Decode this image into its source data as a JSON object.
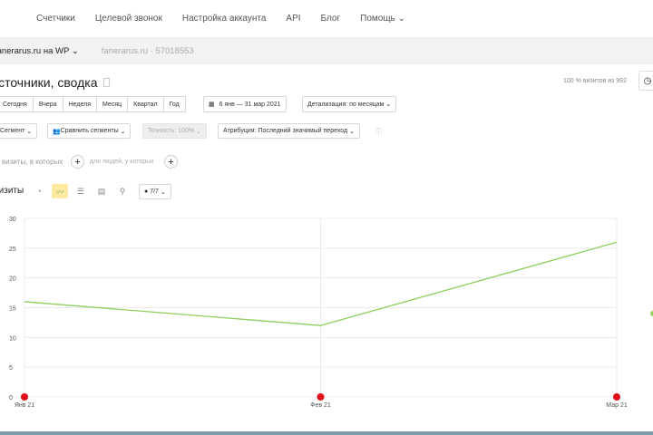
{
  "nav": [
    "Счетчики",
    "Целевой звонок",
    "Настройка аккаунта",
    "API",
    "Блог",
    "Помощь"
  ],
  "counter": {
    "name": "fanerarus.ru на WP",
    "site": "fanerarus.ru · 57018553"
  },
  "title": "Источники, сводка",
  "stat": "100 % визитов из 992",
  "periods": [
    "Сегодня",
    "Вчера",
    "Неделя",
    "Месяц",
    "Квартал",
    "Год"
  ],
  "date_range": "6 янв — 31 мар 2021",
  "detail": "Детализация: по месяцам",
  "segment": "Сегмент",
  "compare": "Сравнить сегменты",
  "accuracy": "Точность: 100%",
  "attribution": "Атрибуция: Последний значимый переход",
  "filter1": "визиты, в которых",
  "filter2": "для людей, у которых",
  "metric": "Визиты",
  "series_count": "7/7",
  "colors": {
    "line": "#8fcf5a",
    "marker": "#e0101a",
    "accent": "#fde9a0"
  },
  "chart_data": {
    "type": "line",
    "categories": [
      "Янв 21",
      "Фев 21",
      "Мар 21"
    ],
    "values": [
      16,
      12,
      26
    ],
    "ylim": [
      0,
      30
    ],
    "yticks": [
      0,
      5,
      10,
      15,
      20,
      25,
      30
    ],
    "grid": true
  }
}
